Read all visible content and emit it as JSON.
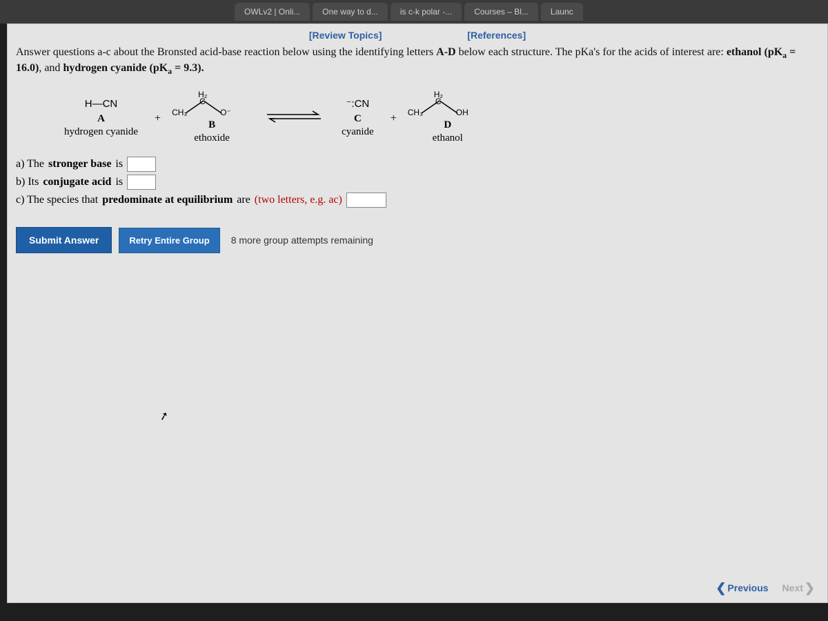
{
  "tabs": {
    "t1": "OWLv2 | Onli...",
    "t2": "One way to d...",
    "t3": "is c-k polar -...",
    "t4": "Courses – Bl...",
    "t5": "Launc"
  },
  "links": {
    "review": "[Review Topics]",
    "references": "[References]"
  },
  "instruction": {
    "line1a": "Answer questions a-c about the Bronsted acid-base reaction below using the identifying letters ",
    "line1b": "A-D",
    "line1c": " below each structure. The pKa's for the acids of interest are: ",
    "eth": "ethanol (pK",
    "sub": "a",
    "etheq": " = 16.0)",
    "and": ", and ",
    "hcn": "hydrogen cyanide (pK",
    "hcneq": " = 9.3).",
    "close": ""
  },
  "reaction": {
    "A": {
      "struct": "H—CN",
      "letter": "A",
      "name": "hydrogen cyanide"
    },
    "B": {
      "ch3": "CH₃",
      "h2": "H₂",
      "c": "C",
      "o": "O⁻",
      "letter": "B",
      "name": "ethoxide"
    },
    "C": {
      "struct": "⁻:CN",
      "letter": "C",
      "name": "cyanide"
    },
    "D": {
      "ch3": "CH₃",
      "h2": "H₂",
      "c": "C",
      "oh": "OH",
      "letter": "D",
      "name": "ethanol"
    },
    "plus": "+",
    "arrow": "⇌"
  },
  "questions": {
    "a_pre": "a) The ",
    "a_bold": "stronger base",
    "a_post": " is",
    "b_pre": "b) Its ",
    "b_bold": "conjugate acid",
    "b_post": " is",
    "c_pre": "c) The species that ",
    "c_bold": "predominate at equilibrium",
    "c_post": " are ",
    "c_hint": "(two letters, e.g. ac)"
  },
  "buttons": {
    "submit": "Submit Answer",
    "retry": "Retry Entire Group",
    "attempts": "8 more group attempts remaining"
  },
  "nav": {
    "prev": "Previous",
    "next": "Next"
  }
}
